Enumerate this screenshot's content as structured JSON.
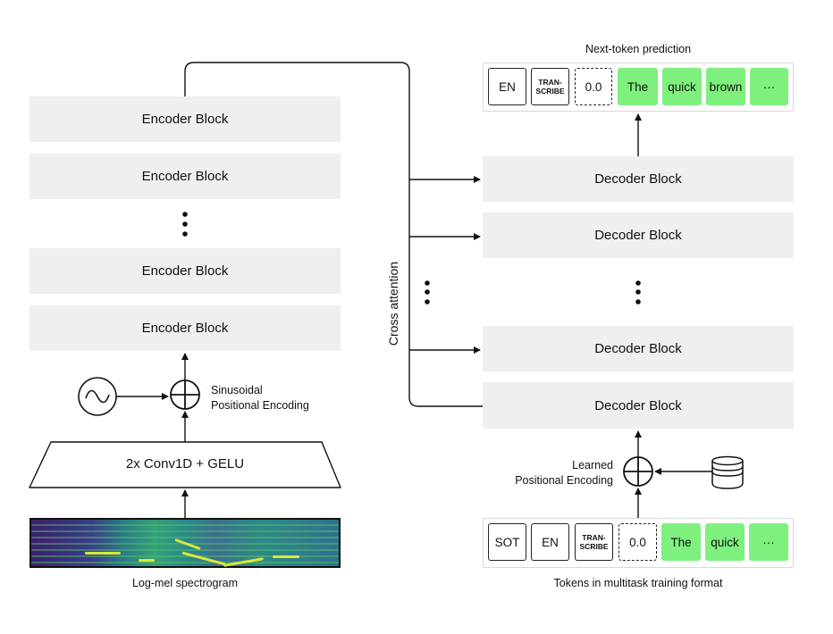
{
  "encoder": {
    "blocks": [
      "Encoder Block",
      "Encoder Block",
      "Encoder Block",
      "Encoder Block"
    ],
    "conv_label": "2x Conv1D + GELU",
    "positional_label_line1": "Sinusoidal",
    "positional_label_line2": "Positional Encoding",
    "input_label": "Log-mel spectrogram"
  },
  "cross_attention_label": "Cross attention",
  "decoder": {
    "blocks": [
      "Decoder Block",
      "Decoder Block",
      "Decoder Block",
      "Decoder Block"
    ],
    "positional_label_line1": "Learned",
    "positional_label_line2": "Positional Encoding"
  },
  "output_tokens": {
    "title": "Next-token prediction",
    "tokens": [
      "EN",
      "TRAN-\nSCRIBE",
      "0.0",
      "The",
      "quick",
      "brown",
      "···"
    ]
  },
  "input_tokens": {
    "title": "Tokens in multitask training format",
    "tokens": [
      "SOT",
      "EN",
      "TRAN-\nSCRIBE",
      "0.0",
      "The",
      "quick",
      "···"
    ]
  },
  "colors": {
    "block_fill": "#efefef",
    "token_green": "#7ef07e",
    "line": "#111111"
  },
  "icons": [
    "sine-wave-icon",
    "plus-circle-icon",
    "database-icon"
  ]
}
